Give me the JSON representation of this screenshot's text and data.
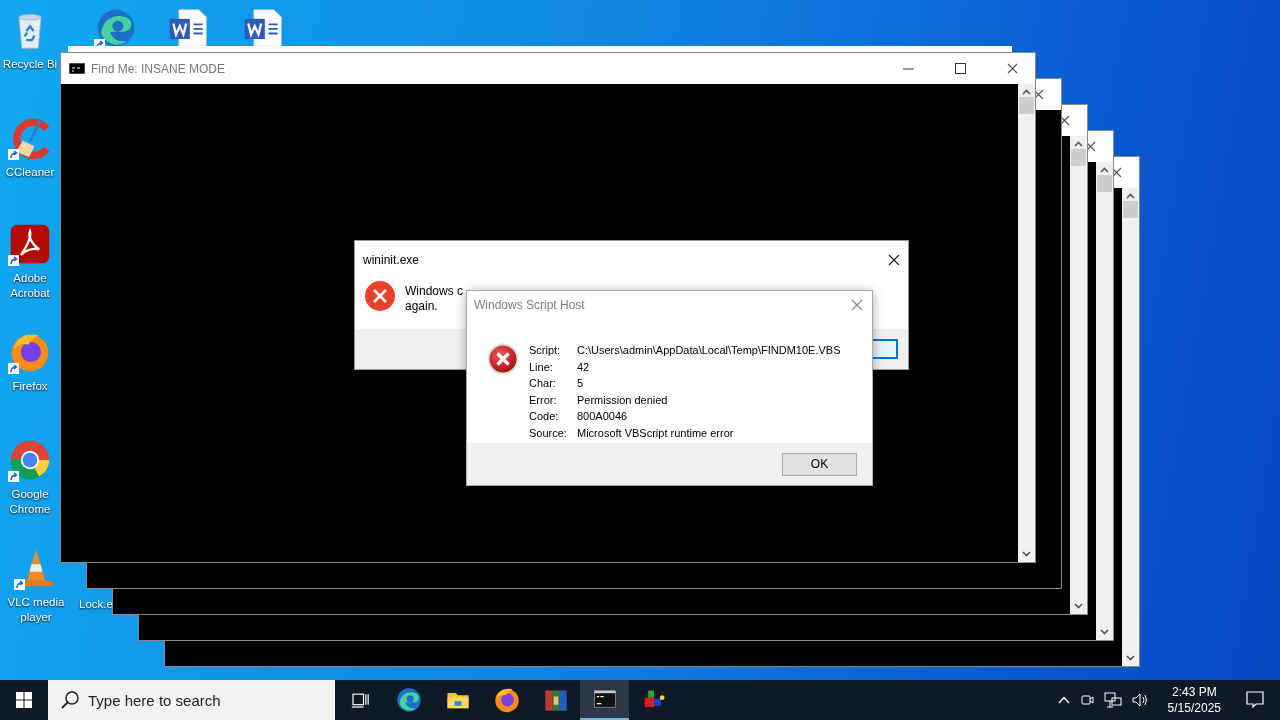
{
  "desktop": {
    "icons": [
      {
        "kind": "recycle-bin",
        "label": "Recycle Bi",
        "shortcut": false
      },
      {
        "kind": "cleaner",
        "label": "CCleaner",
        "shortcut": true
      },
      {
        "kind": "pdf",
        "label": "Adobe Acrobat",
        "shortcut": true
      },
      {
        "kind": "firefox",
        "label": "Firefox",
        "shortcut": true
      },
      {
        "kind": "chrome",
        "label": "Google Chrome",
        "shortcut": true
      },
      {
        "kind": "vlc",
        "label": "VLC media player",
        "shortcut": true
      }
    ],
    "top_icons": [
      {
        "kind": "edge",
        "shortcut": true
      },
      {
        "kind": "word",
        "shortcut": false
      },
      {
        "kind": "word",
        "shortcut": false
      }
    ],
    "partial_labels": [
      {
        "label": "Lock.e"
      }
    ]
  },
  "console_window": {
    "title": "Find Me: INSANE MODE"
  },
  "wininit_dialog": {
    "title": "wininit.exe",
    "message_parts": [
      "Windows c",
      "again."
    ]
  },
  "script_host_dialog": {
    "title": "Windows Script Host",
    "fields": [
      {
        "label": "Script:",
        "value": "C:\\Users\\admin\\AppData\\Local\\Temp\\FINDM10E.VBS"
      },
      {
        "label": "Line:",
        "value": "42"
      },
      {
        "label": "Char:",
        "value": "5"
      },
      {
        "label": "Error:",
        "value": "Permission denied"
      },
      {
        "label": "Code:",
        "value": "800A0046"
      },
      {
        "label": "Source:",
        "value": "Microsoft VBScript runtime error"
      }
    ],
    "button": "OK"
  },
  "taskbar": {
    "search": {
      "placeholder": "Type here to search"
    },
    "apps": [
      {
        "kind": "task-view",
        "active": false
      },
      {
        "kind": "edge",
        "active": false
      },
      {
        "kind": "explorer",
        "active": false
      },
      {
        "kind": "firefox",
        "active": false
      },
      {
        "kind": "winrar",
        "active": false
      },
      {
        "kind": "cmd",
        "active": true
      },
      {
        "kind": "cubes",
        "active": false
      }
    ],
    "clock": {
      "time": "2:43 PM",
      "date": "5/15/2025"
    }
  }
}
